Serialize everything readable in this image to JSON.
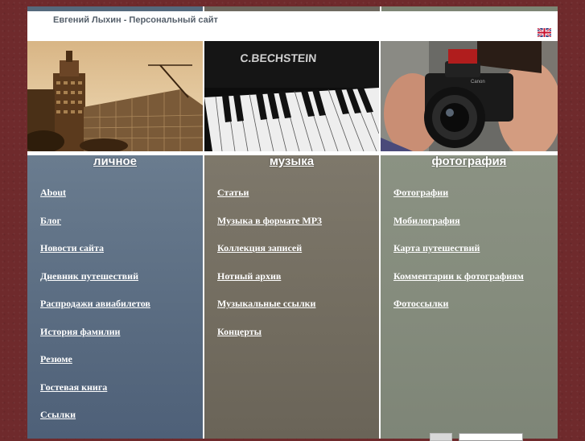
{
  "header": {
    "site_title": "Евгений Лыхин - Персональный сайт",
    "language_flag": "uk-flag-icon"
  },
  "colors": {
    "background": "#6f2a2c",
    "col_personal": "#5f7287",
    "col_music": "#766f62",
    "col_photo": "#868d7f",
    "topbar_personal": "#55697c",
    "topbar_music": "#6e695f",
    "topbar_photo": "#7d8574"
  },
  "columns": [
    {
      "title": "личное",
      "items": [
        "About",
        "Блог",
        "Новости сайта",
        "Дневник путешествий",
        "Распродажи авиабилетов",
        "История фамилии",
        "Резюме",
        "Гостевая книга",
        "Ссылки"
      ]
    },
    {
      "title": "музыка",
      "items": [
        "Статьи",
        "Музыка в формате MP3",
        "Коллекция записей",
        "Нотный архив",
        "Музыкальные ссылки",
        "Концерты"
      ]
    },
    {
      "title": "фотография",
      "items": [
        "Фотографии",
        "Мобилография",
        "Карта путешествий",
        "Комментарии к фотографиям",
        "Фотоссылки"
      ]
    }
  ],
  "photos": {
    "building": "building-photo",
    "piano_brand": "C.BECHSTEIN",
    "camera": "camera-photo"
  }
}
